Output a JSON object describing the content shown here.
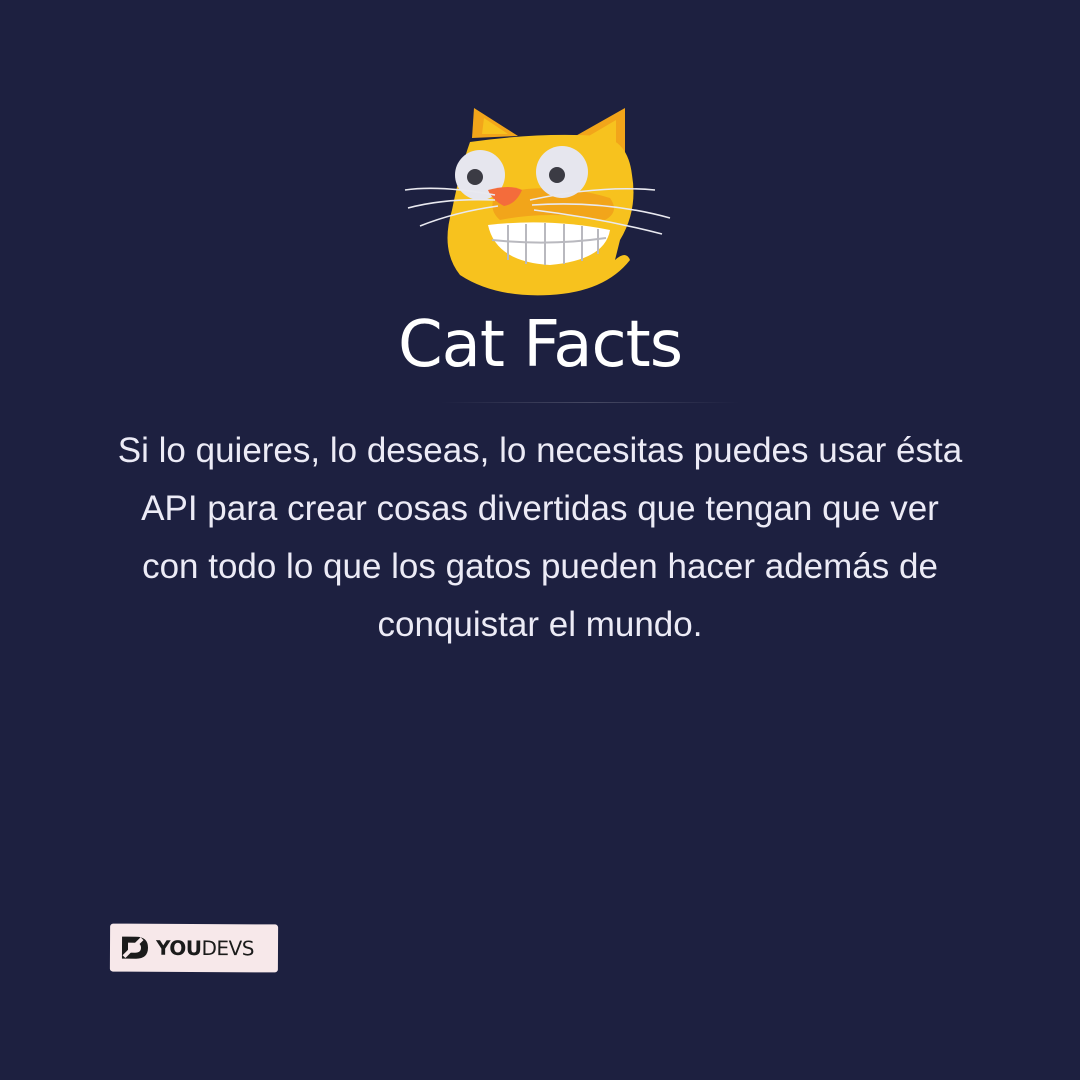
{
  "colors": {
    "background": "#1d2040",
    "text": "#ecebf6",
    "title": "#ffffff",
    "cat_fur": "#f7c21e",
    "cat_fur_dark": "#f2a51a",
    "cat_nose": "#f46c3b",
    "brand_badge_bg": "#f7e8ea",
    "brand_badge_text": "#1b1b1b"
  },
  "mascot": {
    "icon": "grinning-cat-face-icon"
  },
  "title": "Cat Facts",
  "description": "Si lo quieres, lo deseas, lo necesitas puedes usar ésta API para crear cosas divertidas que tengan que ver con todo lo que los gatos pueden hacer además de conquistar el mundo.",
  "brand": {
    "icon": "youdevs-logo-icon",
    "name_strong": "YOU",
    "name_light": "DEVS"
  }
}
